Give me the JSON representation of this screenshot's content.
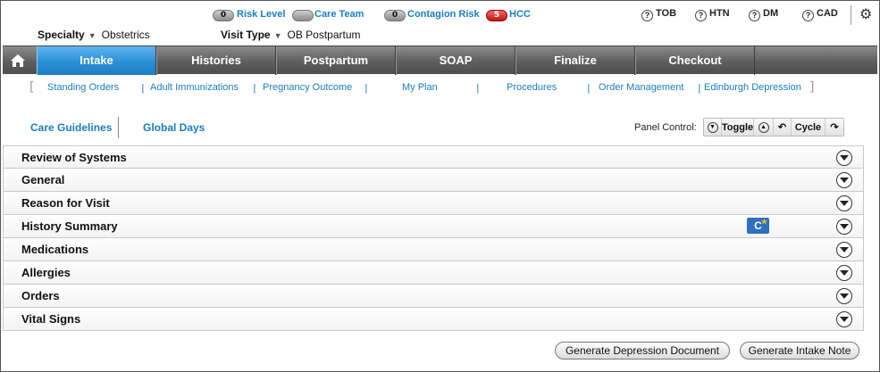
{
  "top_status": {
    "risk_level": {
      "count": "0",
      "label": "Risk Level"
    },
    "care_team": {
      "count": "",
      "label": "Care Team"
    },
    "contagion_risk": {
      "count": "0",
      "label": "Contagion Risk"
    },
    "hcc": {
      "count": "5",
      "label": "HCC"
    },
    "quick_items": [
      "TOB",
      "HTN",
      "DM",
      "CAD"
    ]
  },
  "fields": {
    "specialty_label": "Specialty",
    "specialty_value": "Obstetrics",
    "visit_type_label": "Visit Type",
    "visit_type_value": "OB Postpartum"
  },
  "main_tabs": [
    "Intake",
    "Histories",
    "Postpartum",
    "SOAP",
    "Finalize",
    "Checkout"
  ],
  "active_tab": "Intake",
  "sub_nav": [
    "Standing Orders",
    "Adult Immunizations",
    "Pregnancy Outcome",
    "My Plan",
    "Procedures",
    "Order Management",
    "Edinburgh Depression"
  ],
  "guidelines": {
    "care_guidelines": "Care Guidelines",
    "global_days": "Global Days"
  },
  "panel_control": {
    "label": "Panel Control:",
    "toggle": "Toggle",
    "cycle": "Cycle"
  },
  "panels": [
    "Review of Systems",
    "General",
    "Reason for Visit",
    "History Summary",
    "Medications",
    "Allergies",
    "Orders",
    "Vital Signs"
  ],
  "buttons": {
    "generate_depression": "Generate Depression Document",
    "generate_intake": "Generate Intake Note"
  },
  "colors": {
    "link_blue": "#1a7dc0",
    "active_tab": "#2b8fd6",
    "nav_gray": "#5f5f5f",
    "hcc_red": "#c41414"
  }
}
